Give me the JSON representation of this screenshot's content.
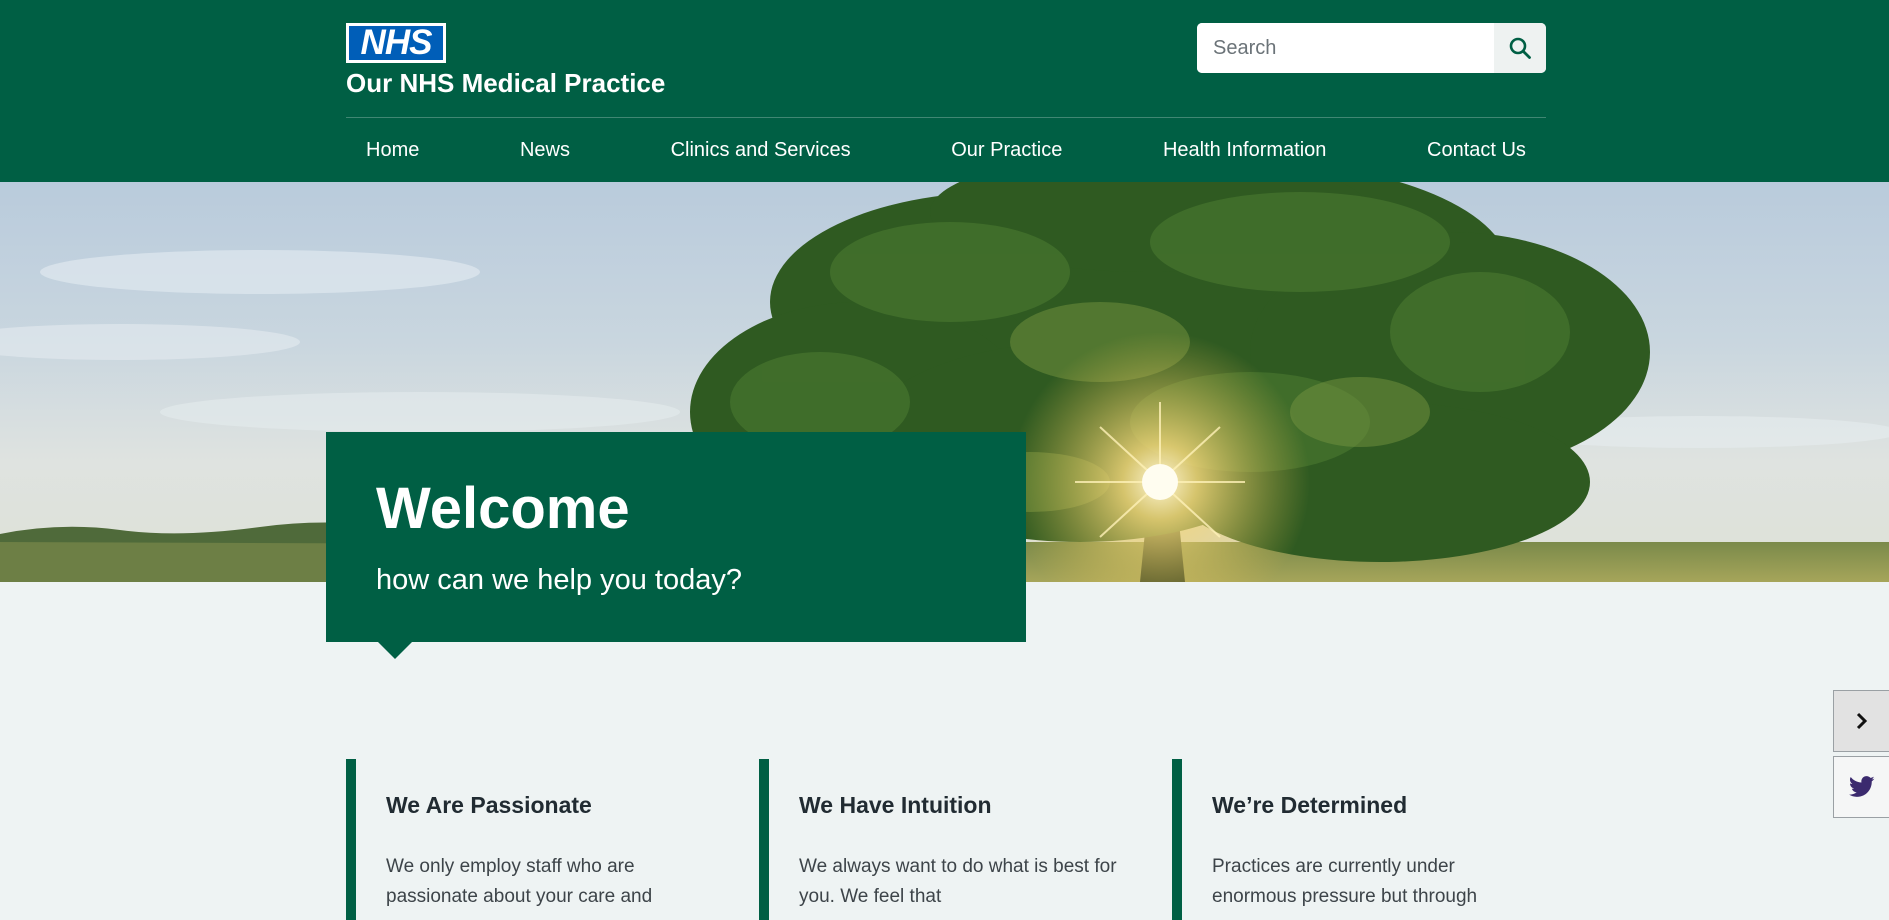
{
  "header": {
    "logo_text": "NHS",
    "site_title": "Our NHS Medical Practice",
    "search": {
      "placeholder": "Search"
    }
  },
  "nav": {
    "items": [
      {
        "label": "Home"
      },
      {
        "label": "News"
      },
      {
        "label": "Clinics and Services"
      },
      {
        "label": "Our Practice"
      },
      {
        "label": "Health Information"
      },
      {
        "label": "Contact Us"
      }
    ]
  },
  "hero": {
    "title": "Welcome",
    "subtitle": "how can we help you today?"
  },
  "cards": [
    {
      "title": "We Are Passionate",
      "text": "We only employ staff who are passionate about your care and"
    },
    {
      "title": "We Have Intuition",
      "text": "We always want to do what is best for you. We feel that"
    },
    {
      "title": "We’re Determined",
      "text": "Practices are currently under enormous pressure but through"
    }
  ],
  "side": {
    "expand_icon": "chevron-right-icon",
    "social_icon": "twitter-icon"
  },
  "colors": {
    "brand_green": "#005f44",
    "nhs_blue": "#005eb8",
    "page_bg": "#eef3f3",
    "twitter": "#3b2a6e"
  }
}
